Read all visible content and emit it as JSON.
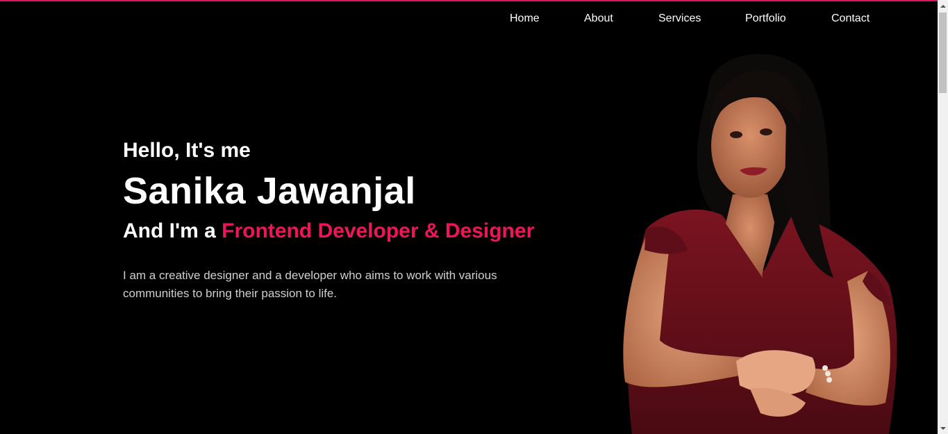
{
  "nav": {
    "items": [
      "Home",
      "About",
      "Services",
      "Portfolio",
      "Contact"
    ]
  },
  "hero": {
    "greeting": "Hello, It's me",
    "name": "Sanika Jawanjal",
    "role_prefix": "And I'm a ",
    "role_highlight": "Frontend Developer & Designer",
    "description": "I am a creative designer and a developer who aims to work with various communities to bring their passion to life."
  },
  "colors": {
    "background": "#000000",
    "accent": "#f0145a",
    "text": "#ffffff"
  },
  "icons": {
    "scroll_up": "arrow-up-icon",
    "scroll_down": "arrow-down-icon"
  }
}
